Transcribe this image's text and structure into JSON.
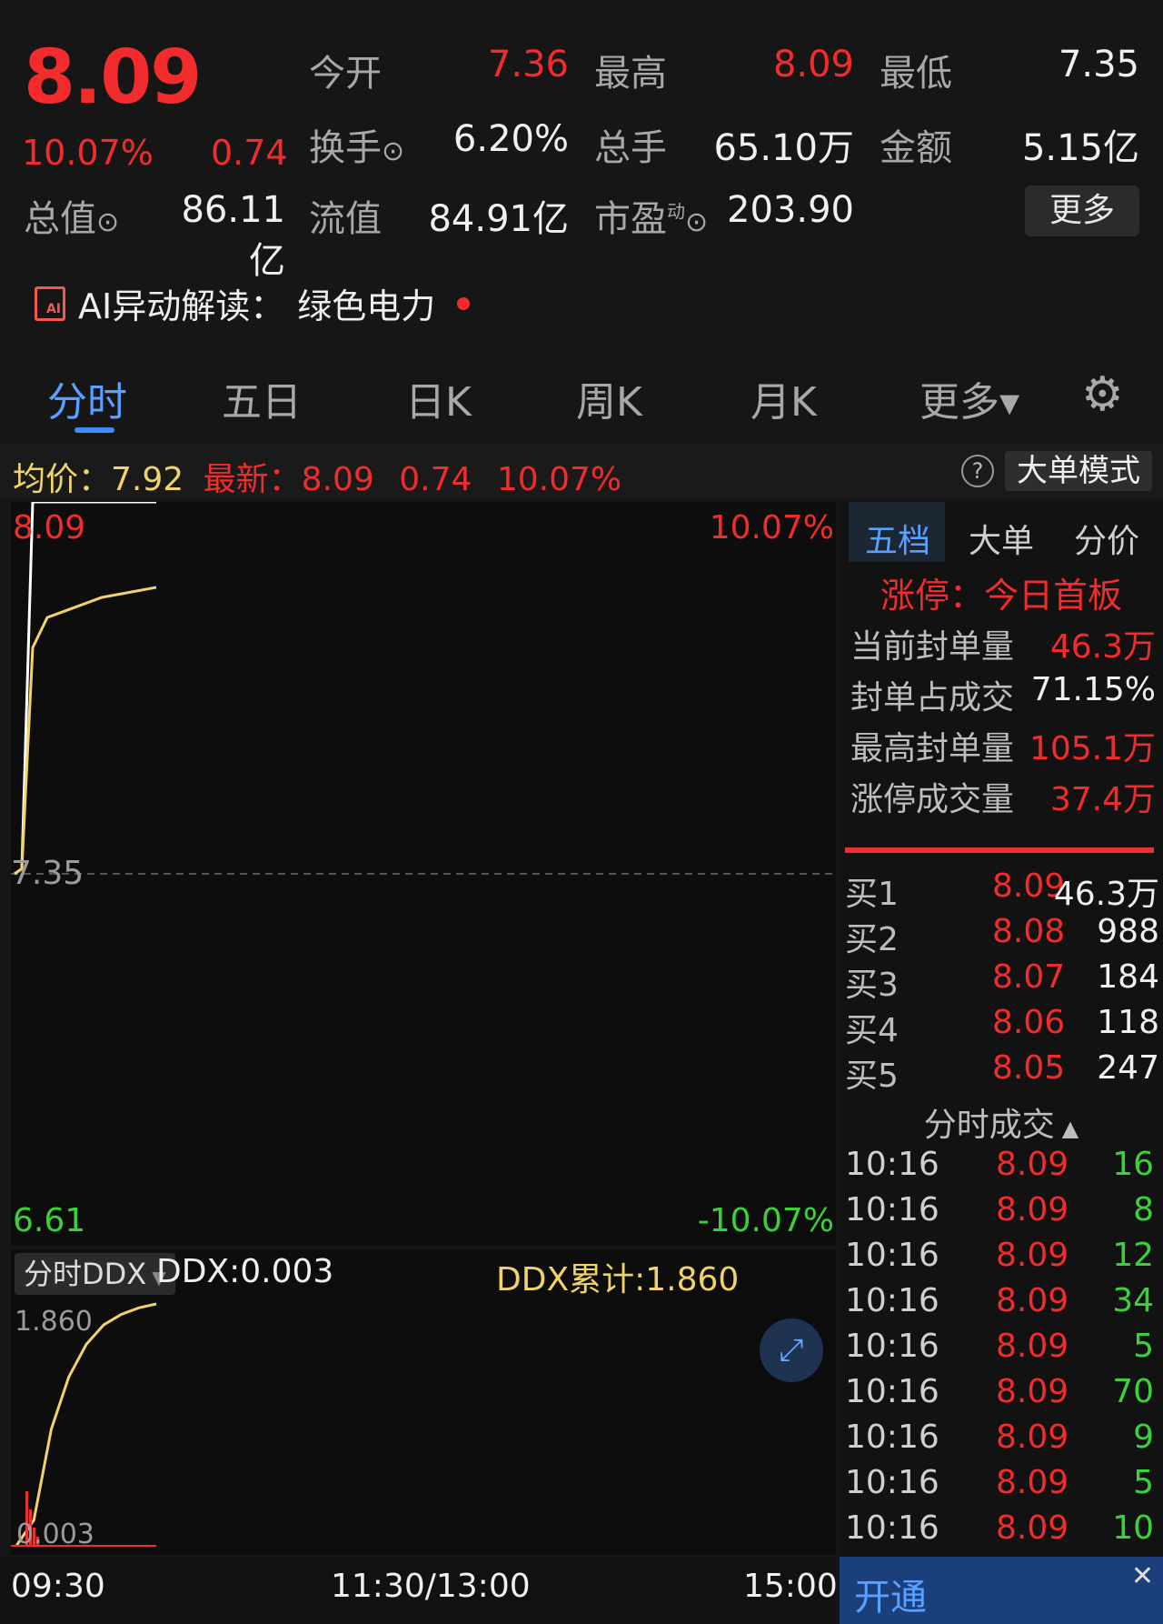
{
  "quote": {
    "price": "8.09",
    "change_pct": "10.07%",
    "change_abs": "0.74",
    "stats": [
      {
        "label": "今开",
        "value": "7.36"
      },
      {
        "label": "最高",
        "value": "8.09"
      },
      {
        "label": "最低",
        "value": "7.35"
      },
      {
        "label": "换手",
        "value": "6.20%"
      },
      {
        "label": "总手",
        "value": "65.10万"
      },
      {
        "label": "金额",
        "value": "5.15亿"
      },
      {
        "label": "总值",
        "value": "86.11亿"
      },
      {
        "label": "流值",
        "value": "84.91亿"
      },
      {
        "label": "市盈",
        "value": "203.90"
      }
    ],
    "pe_superscript": "动",
    "info_glyph": "⊙",
    "more_label": "更多"
  },
  "ai": {
    "icon_text": "AI",
    "prefix": "AI异动解读：",
    "topic": "绿色电力"
  },
  "tabs": [
    "分时",
    "五日",
    "日K",
    "周K",
    "月K",
    "更多▾"
  ],
  "info_bar": {
    "avg_label": "均价：",
    "avg_value": "7.92",
    "latest_label": "最新：",
    "latest_value": "8.09",
    "latest_change": "0.74",
    "latest_pct": "10.07%",
    "help_icon": "?",
    "mode_button": "大单模式"
  },
  "chart_data": [
    {
      "type": "line",
      "series": [
        {
          "values": [
            7.35,
            7.36,
            8.09,
            8.09,
            8.09,
            8.09,
            8.09,
            8.09
          ]
        },
        {
          "values": [
            7.35,
            7.36,
            7.8,
            7.86,
            7.88,
            7.9,
            7.91,
            7.92
          ]
        }
      ],
      "ylim": [
        6.61,
        8.09
      ],
      "y_labels": {
        "top": "8.09",
        "mid": "7.35",
        "bottom": "6.61",
        "top_pct": "10.07%",
        "bottom_pct": "-10.07%"
      },
      "x_ticks": [
        "09:30",
        "11:30/13:00",
        "15:00"
      ]
    },
    {
      "type": "line",
      "indicator_label": "分时DDX",
      "ddx_label": "DDX:0.003",
      "ddx_cum_label": "DDX累计:1.860",
      "series": [
        {
          "values": [
            0.0,
            0.2,
            0.9,
            1.3,
            1.55,
            1.7,
            1.78,
            1.83,
            1.86
          ]
        }
      ],
      "ylim": [
        0.003,
        1.86
      ],
      "y_labels": {
        "top": "1.860",
        "bottom": "0.003"
      }
    }
  ],
  "right_panel": {
    "tabs": [
      "五档",
      "大单",
      "分价"
    ],
    "limit_title": "涨停：今日首板",
    "limit_rows": [
      {
        "label": "当前封单量",
        "value": "46.3万",
        "color": "#f22c2c"
      },
      {
        "label": "封单占成交",
        "value": "71.15%",
        "color": "#f0f0f0"
      },
      {
        "label": "最高封单量",
        "value": "105.1万",
        "color": "#f22c2c"
      },
      {
        "label": "涨停成交量",
        "value": "37.4万",
        "color": "#f22c2c"
      }
    ],
    "order_book": [
      {
        "label": "买1",
        "price": "8.09",
        "qty": "46.3万"
      },
      {
        "label": "买2",
        "price": "8.08",
        "qty": "988"
      },
      {
        "label": "买3",
        "price": "8.07",
        "qty": "184"
      },
      {
        "label": "买4",
        "price": "8.06",
        "qty": "118"
      },
      {
        "label": "买5",
        "price": "8.05",
        "qty": "247"
      }
    ],
    "trades_title": "分时成交",
    "trades": [
      {
        "time": "10:16",
        "price": "8.09",
        "qty": "16"
      },
      {
        "time": "10:16",
        "price": "8.09",
        "qty": "8"
      },
      {
        "time": "10:16",
        "price": "8.09",
        "qty": "12"
      },
      {
        "time": "10:16",
        "price": "8.09",
        "qty": "34"
      },
      {
        "time": "10:16",
        "price": "8.09",
        "qty": "5"
      },
      {
        "time": "10:16",
        "price": "8.09",
        "qty": "70"
      },
      {
        "time": "10:16",
        "price": "8.09",
        "qty": "9"
      },
      {
        "time": "10:16",
        "price": "8.09",
        "qty": "5"
      },
      {
        "time": "10:16",
        "price": "8.09",
        "qty": "10"
      }
    ],
    "banner_text": "开通"
  }
}
